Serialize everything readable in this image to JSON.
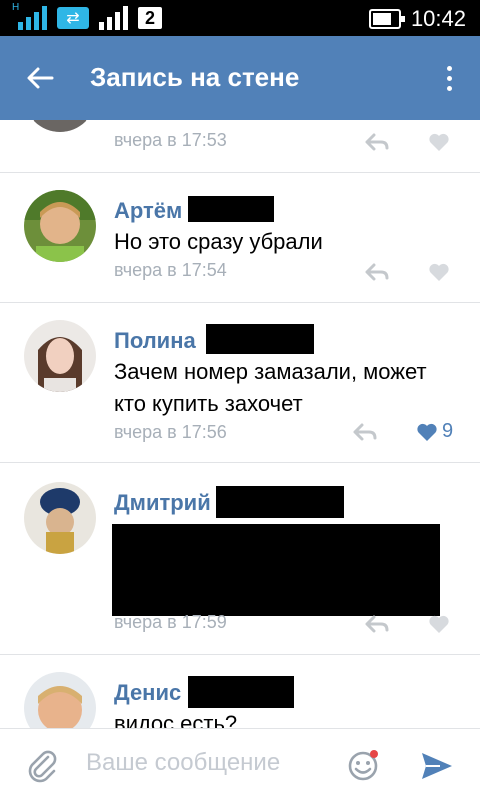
{
  "status_bar": {
    "time": "10:42",
    "sim_number": "2",
    "network": "H"
  },
  "app_bar": {
    "title": "Запись на стене"
  },
  "comments": [
    {
      "name": "",
      "text": "",
      "time": "вчера в 17:53",
      "likes": ""
    },
    {
      "name": "Артём",
      "text": "Но это сразу убрали",
      "time": "вчера в 17:54",
      "likes": ""
    },
    {
      "name": "Полина",
      "text": "Зачем номер замазали, может кто купить захочет",
      "time": "вчера в 17:56",
      "likes": "9"
    },
    {
      "name": "Дмитрий",
      "text": "",
      "time": "вчера в 17:59",
      "likes": ""
    },
    {
      "name": "Денис",
      "text": "видос есть?",
      "time": "",
      "likes": ""
    }
  ],
  "composer": {
    "placeholder": "Ваше сообщение"
  },
  "colors": {
    "app_bar": "#5181b8",
    "name": "#4a76a8",
    "time": "#a7afb8",
    "liked": "#5181b8"
  }
}
